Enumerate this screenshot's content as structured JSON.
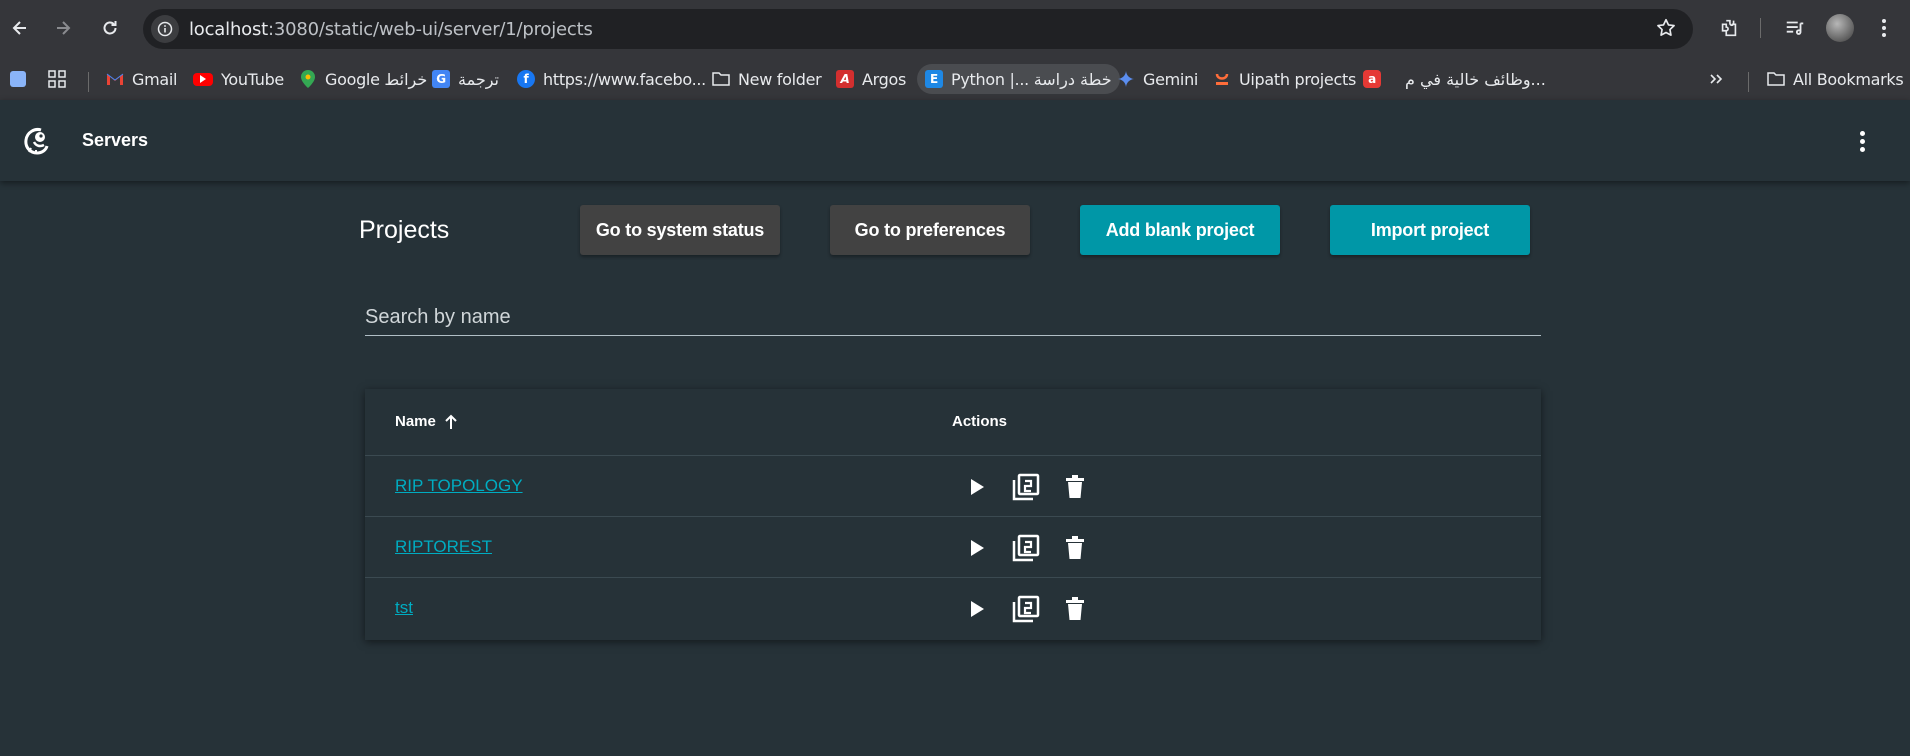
{
  "browser": {
    "url_host": "localhost",
    "url_port_path": ":3080/static/web-ui/server/1/projects",
    "bookmarks": [
      {
        "label": "Gmail",
        "icon": "gmail-icon"
      },
      {
        "label": "YouTube",
        "icon": "youtube-icon"
      },
      {
        "label": "Google خرائط",
        "icon": "google-maps-icon"
      },
      {
        "label": "ترجمة",
        "icon": "google-translate-icon"
      },
      {
        "label": "https://www.facebo...",
        "icon": "facebook-icon"
      },
      {
        "label": "New folder",
        "icon": "folder-icon"
      },
      {
        "label": "Argos",
        "icon": "argos-icon"
      },
      {
        "label": "Python |... خطة دراسة",
        "icon": "e-icon"
      },
      {
        "label": "Gemini",
        "icon": "gemini-icon"
      },
      {
        "label": "Uipath projects",
        "icon": "uipath-icon"
      },
      {
        "label": "وظائف خالية في م...",
        "icon": "jobs-icon"
      }
    ],
    "all_bookmarks": "All Bookmarks"
  },
  "app": {
    "title": "Servers"
  },
  "page": {
    "title": "Projects",
    "buttons": {
      "system_status": "Go to system status",
      "preferences": "Go to preferences",
      "add_blank": "Add blank project",
      "import": "Import project"
    },
    "search_placeholder": "Search by name"
  },
  "table": {
    "headers": {
      "name": "Name",
      "actions": "Actions"
    },
    "rows": [
      {
        "name": "RIP TOPOLOGY"
      },
      {
        "name": "RIPTOREST"
      },
      {
        "name": "tst"
      }
    ]
  },
  "colors": {
    "background": "#263238",
    "accent": "#0097a7",
    "link": "#00acc1",
    "secondary_button": "#424242"
  }
}
